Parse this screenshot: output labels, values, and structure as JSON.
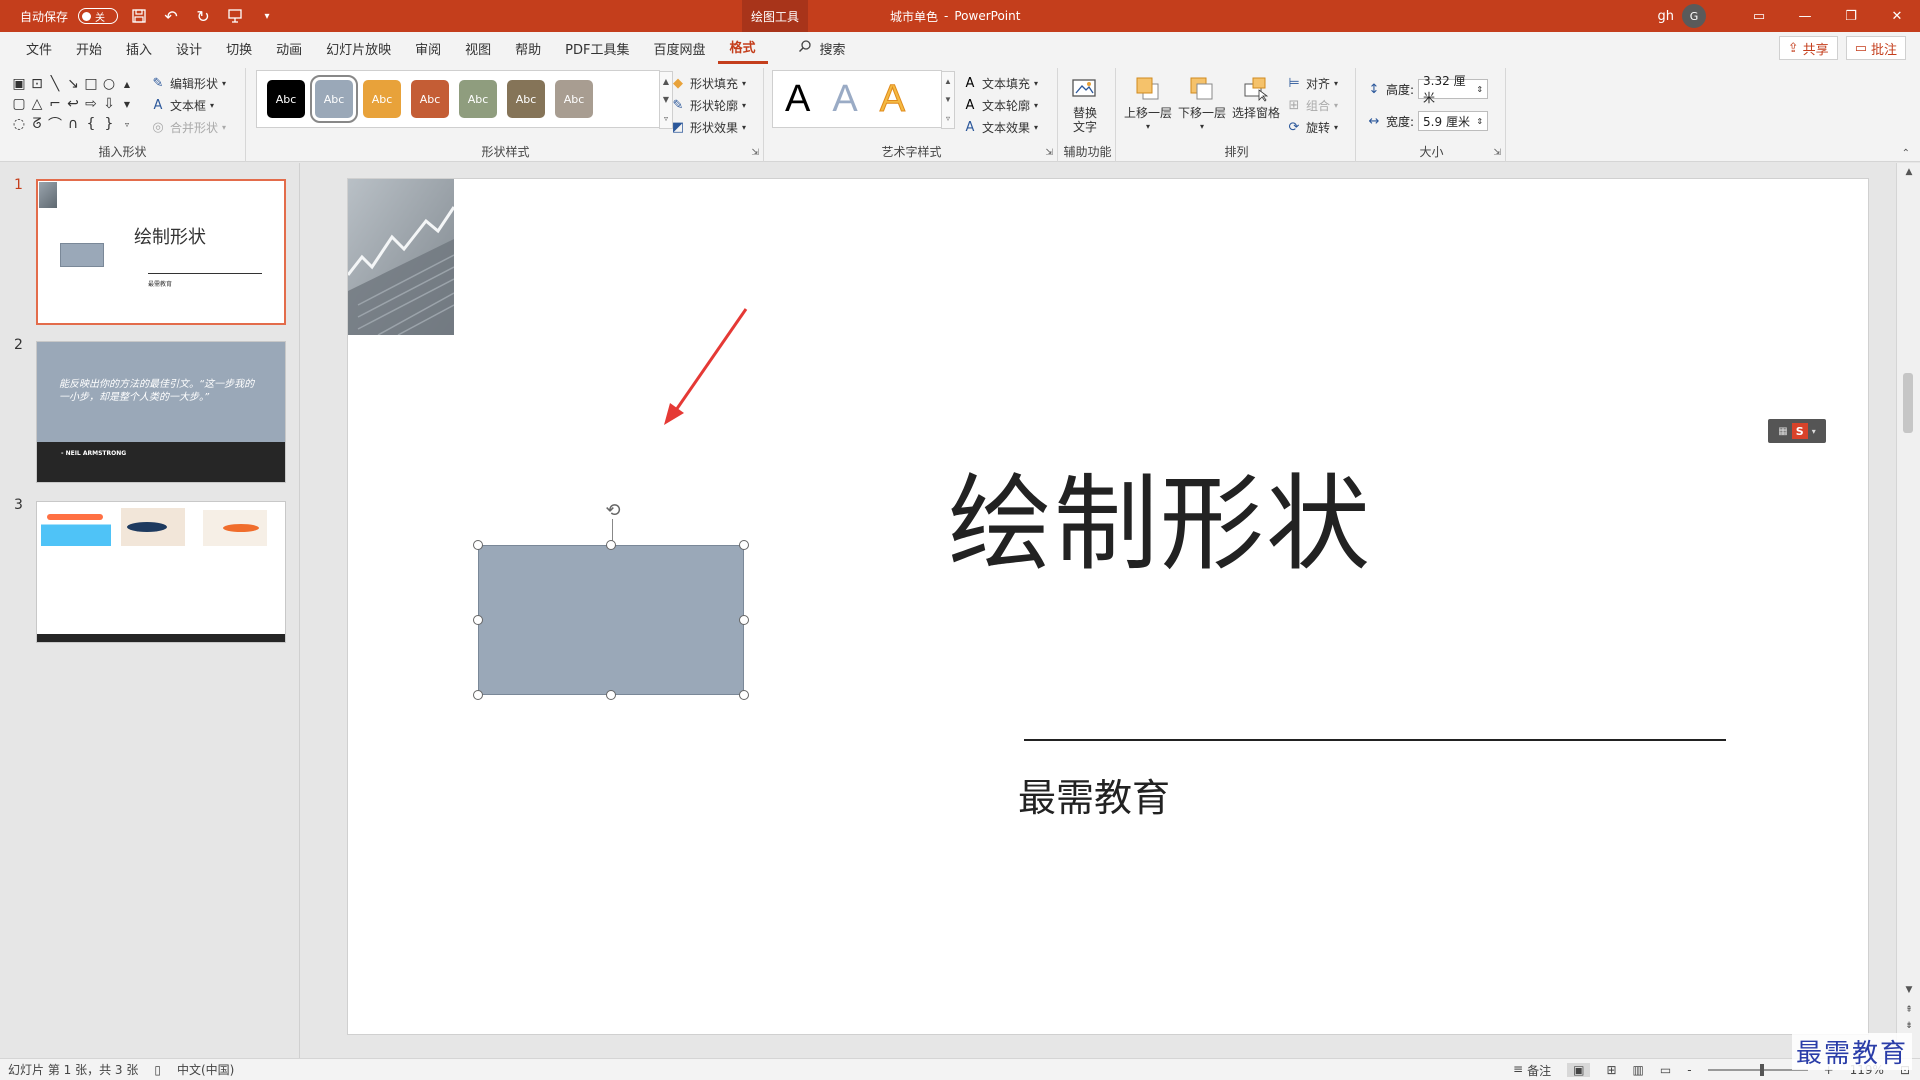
{
  "titlebar": {
    "autosave_label": "自动保存",
    "autosave_state": "关",
    "context_tab": "绘图工具",
    "doc_title": "城市单色",
    "separator": "-",
    "app_name": "PowerPoint",
    "user": "gh",
    "avatar_initial": "G"
  },
  "menu": {
    "tabs": [
      "文件",
      "开始",
      "插入",
      "设计",
      "切换",
      "动画",
      "幻灯片放映",
      "审阅",
      "视图",
      "帮助",
      "PDF工具集",
      "百度网盘",
      "格式"
    ],
    "active_tab": "格式",
    "search_label": "搜索",
    "share_label": "共享",
    "comment_label": "批注"
  },
  "ribbon": {
    "insert_shapes": {
      "label": "插入形状",
      "edit_shape": "编辑形状",
      "text_box": "文本框",
      "merge_shapes": "合并形状"
    },
    "shape_styles": {
      "label": "形状样式",
      "swatches": [
        {
          "text": "Abc",
          "color": "#000000"
        },
        {
          "text": "Abc",
          "color": "#9aa8b8"
        },
        {
          "text": "Abc",
          "color": "#e8a23a"
        },
        {
          "text": "Abc",
          "color": "#c45d35"
        },
        {
          "text": "Abc",
          "color": "#8f9d7e"
        },
        {
          "text": "Abc",
          "color": "#857458"
        },
        {
          "text": "Abc",
          "color": "#a89d91"
        }
      ],
      "selected_index": 1,
      "fill": "形状填充",
      "outline": "形状轮廓",
      "effects": "形状效果"
    },
    "wordart": {
      "label": "艺术字样式",
      "sample": "A",
      "text_fill": "文本填充",
      "text_outline": "文本轮廓",
      "text_effects": "文本效果"
    },
    "accessibility": {
      "label": "辅助功能",
      "alt_text_line1": "替换",
      "alt_text_line2": "文字"
    },
    "arrange": {
      "label": "排列",
      "bring_forward": "上移一层",
      "send_backward": "下移一层",
      "selection_pane": "选择窗格",
      "align": "对齐",
      "group": "组合",
      "rotate": "旋转"
    },
    "size": {
      "label": "大小",
      "height_label": "高度:",
      "height_value": "3.32 厘米",
      "width_label": "宽度:",
      "width_value": "5.9 厘米"
    }
  },
  "slides_panel": {
    "slides": [
      {
        "number": "1",
        "title": "绘制形状",
        "subtitle": "最需教育"
      },
      {
        "number": "2",
        "quote": "能反映出你的方法的最佳引文。“这一步我的一小步，却是整个人类的一大步。”",
        "author": "- NEIL ARMSTRONG"
      },
      {
        "number": "3"
      }
    ],
    "active_index": 0
  },
  "slide": {
    "title": "绘制形状",
    "subtitle": "最需教育",
    "shape_fill": "#9aa8b8",
    "arrow_color": "#e53935",
    "ime_label": "S"
  },
  "statusbar": {
    "slide_info": "幻灯片 第 1 张，共 3 张",
    "language": "中文(中国)",
    "notes": "备注",
    "zoom_minus": "-",
    "zoom_plus": "+",
    "zoom": "119%"
  },
  "watermark": "最需教育"
}
